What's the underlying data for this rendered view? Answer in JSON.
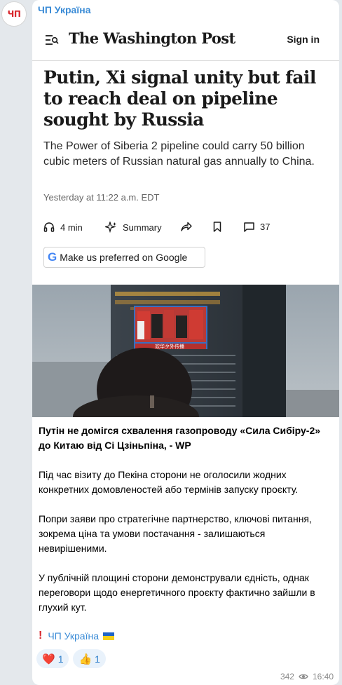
{
  "channel": {
    "avatar_text": "ЧП",
    "name": "ЧП Україна"
  },
  "article": {
    "publication": "The Washington Post",
    "sign_in": "Sign in",
    "headline": "Putin, Xi signal unity but fail to reach deal on pipeline sought by Russia",
    "subheadline": "The Power of Siberia 2 pipeline could carry 50 billion cubic meters of Russian natural gas annually to China.",
    "timestamp": "Yesterday at 11:22 a.m. EDT",
    "read_time": "4 min",
    "summary_label": "Summary",
    "comment_count": "37",
    "google_button": "Make us preferred on Google",
    "screen_caption": "欢华夕外传播"
  },
  "post": {
    "title": "Путін не домігся схвалення газопроводу «Сила Сибіру-2» до Китаю від Сі Цзіньпіна, - WP",
    "paragraphs": [
      "Під час візиту до Пекіна сторони не оголосили жодних конкретних домовленостей або термінів запуску проєкту.",
      "Попри заяви про стратегічне партнерство, ключові питання, зокрема ціна та умови постачання - залишаються невирішеними.",
      "У публічній площині сторони демонстрували єдність, однак переговори щодо енергетичного проєкту фактично зайшли в глухий кут."
    ],
    "signature": "ЧП Україна"
  },
  "reactions": [
    {
      "emoji": "❤️",
      "count": "1"
    },
    {
      "emoji": "👍",
      "count": "1"
    }
  ],
  "meta": {
    "views": "342",
    "time": "16:40"
  },
  "icons": [
    "menu-search-icon",
    "headphones-icon",
    "sparkle-icon",
    "share-arrow-icon",
    "bookmark-icon",
    "comment-icon",
    "google-g-icon",
    "eye-icon",
    "ukraine-flag-icon",
    "exclamation-icon"
  ],
  "colors": {
    "link_blue": "#3a8bd6",
    "brand_red": "#d8262c",
    "reaction_bg": "#e9f2fb",
    "chat_bg": "#e4e8ec"
  }
}
